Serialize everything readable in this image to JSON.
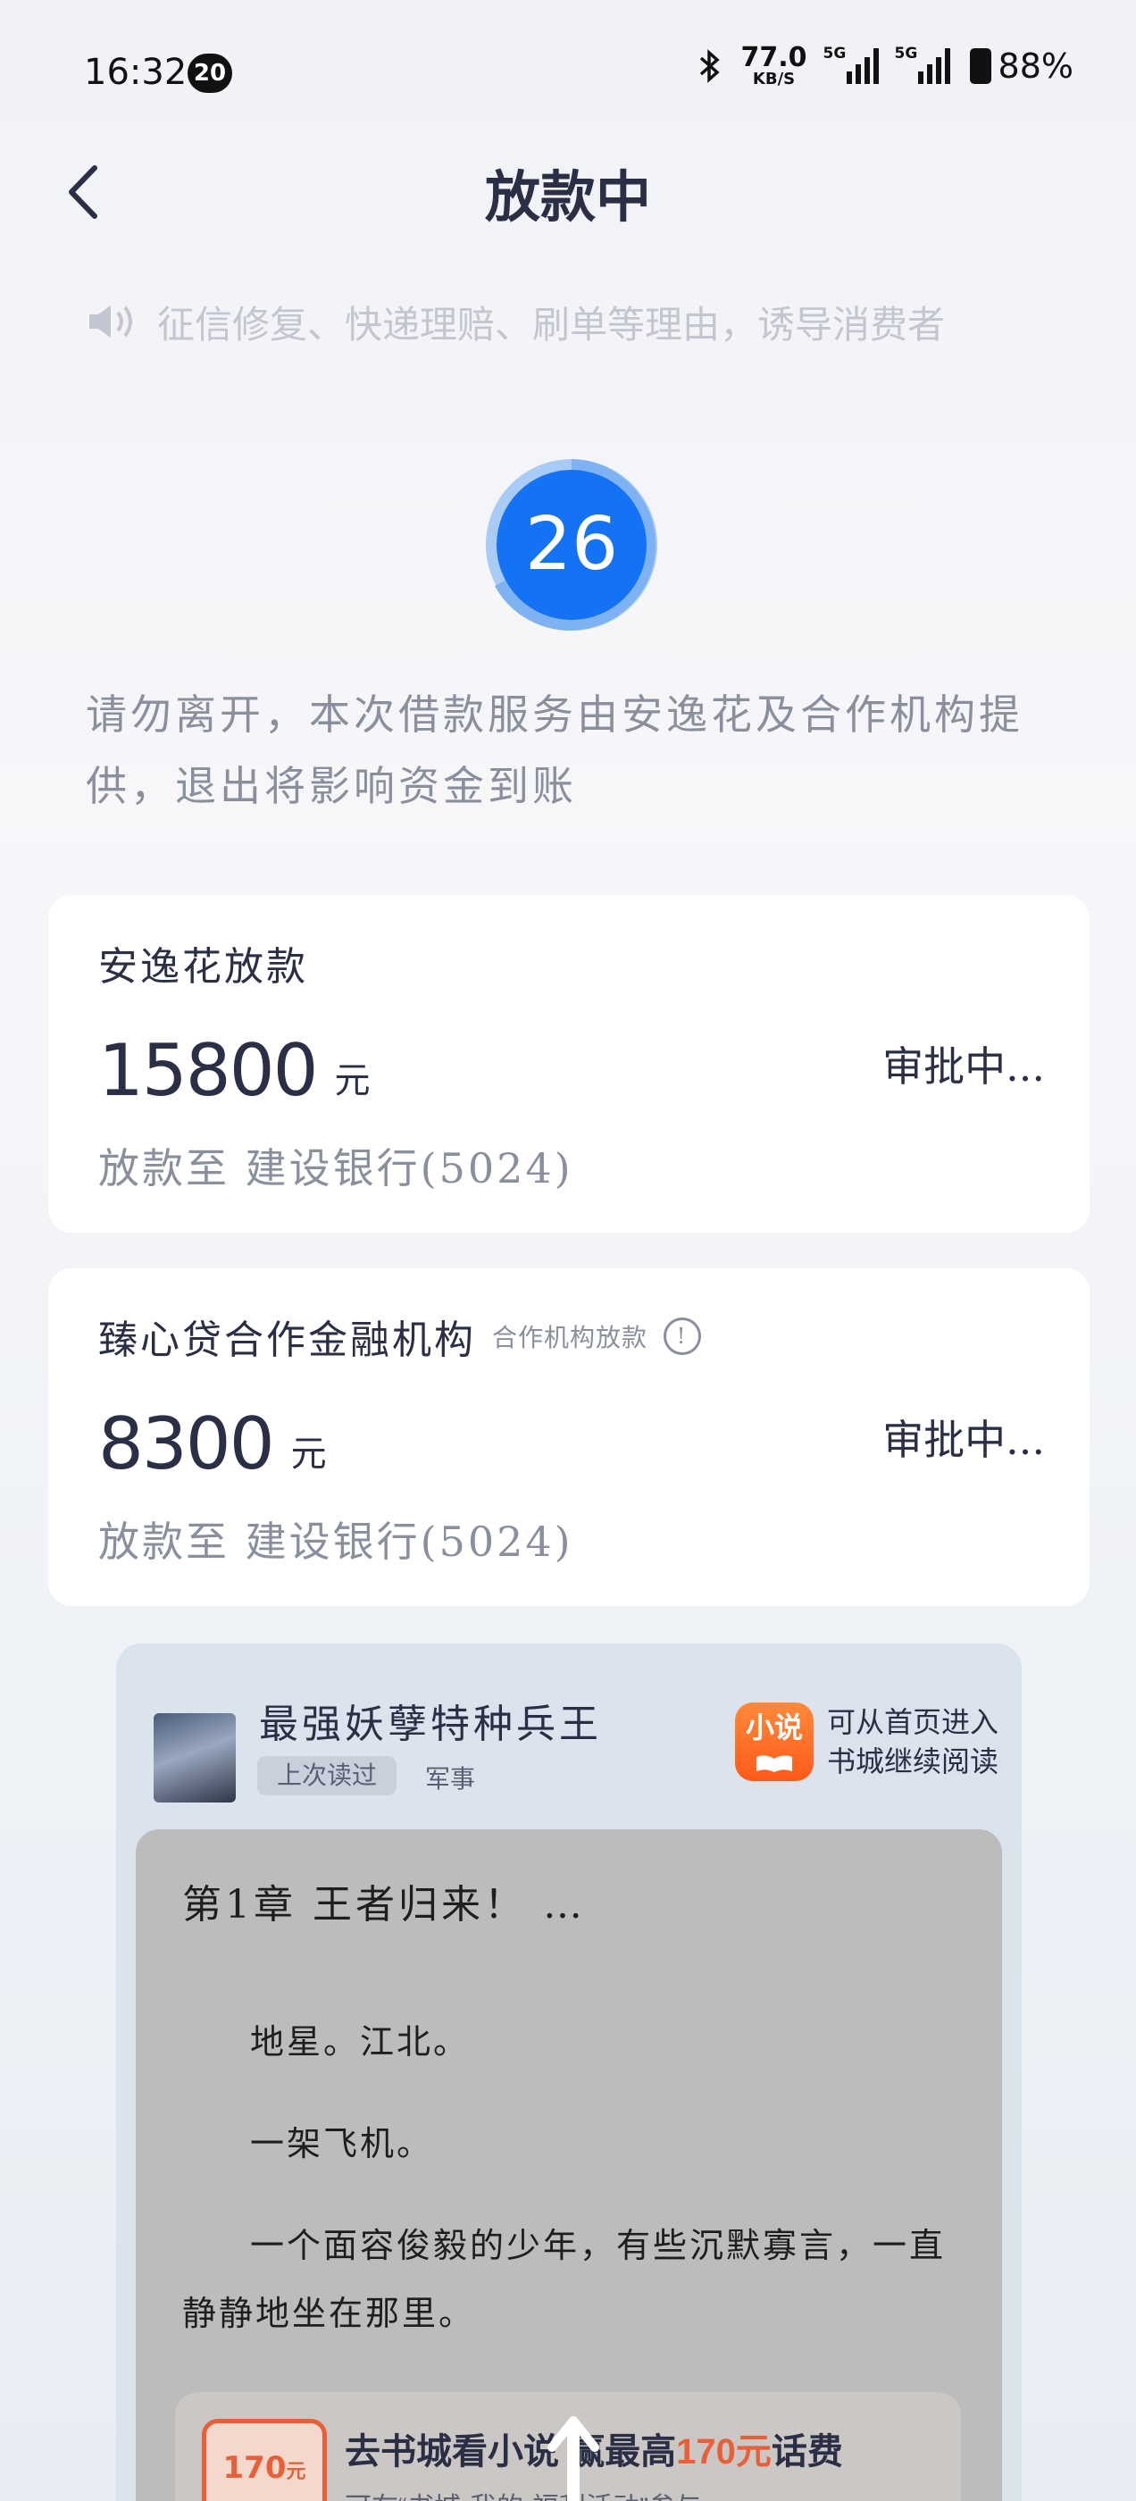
{
  "status_bar": {
    "time": "16:32",
    "notification_count": "20",
    "net_speed_value": "77.0",
    "net_speed_unit": "KB/S",
    "signal1_label": "5G",
    "signal2_label": "5G",
    "battery": "88%"
  },
  "header": {
    "title": "放款中"
  },
  "marquee": {
    "text": "征信修复、快递理赔、刷单等理由，诱导消费者"
  },
  "countdown": {
    "value": "26"
  },
  "notice": {
    "text": "请勿离开，本次借款服务由安逸花及合作机构提供，退出将影响资金到账"
  },
  "loans": [
    {
      "title": "安逸花放款",
      "subtitle": "",
      "amount": "15800",
      "unit": "元",
      "status": "审批中...",
      "bank": "放款至  建设银行(5024)"
    },
    {
      "title": "臻心贷合作金融机构",
      "subtitle": "合作机构放款",
      "amount": "8300",
      "unit": "元",
      "status": "审批中...",
      "bank": "放款至  建设银行(5024)"
    }
  ],
  "novel": {
    "book_title": "最强妖孽特种兵王",
    "last_read_tag": "上次读过",
    "genre": "军事",
    "app_icon_label": "小说",
    "app_hint_line1": "可从首页进入",
    "app_hint_line2": "书城继续阅读",
    "chapter_title": "第1章  王者归来！ …",
    "paragraphs": [
      "地星。江北。",
      "一架飞机。",
      "一个面容俊毅的少年，有些沉默寡言，一直静静地坐在那里。"
    ],
    "promo": {
      "coupon_value": "170",
      "coupon_unit": "元",
      "title_prefix": "去书城看小说 赢最高",
      "title_highlight": "170元",
      "title_suffix": "话费",
      "subtitle": "可在“书城-我的-福利活动”参与"
    }
  },
  "colors": {
    "primary_blue": "#1472f5",
    "text_dark": "#2a2f45",
    "text_muted": "#8a8f9e",
    "accent_orange": "#e8603a"
  }
}
